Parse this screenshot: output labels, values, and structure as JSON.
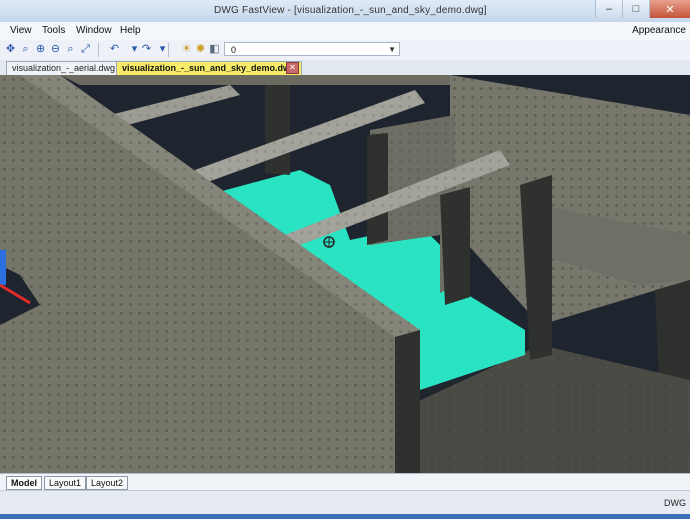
{
  "window": {
    "title": "DWG FastView - [visualization_-_sun_and_sky_demo.dwg]",
    "minimize_glyph": "–",
    "maximize_glyph": "□",
    "close_glyph": "✕"
  },
  "menu": {
    "items": [
      "View",
      "Tools",
      "Window",
      "Help"
    ],
    "right_label": "Appearance"
  },
  "toolbar": {
    "layer_value": "0",
    "icons": [
      "pan-icon",
      "zoom-window-icon",
      "zoom-in-icon",
      "zoom-out-icon",
      "zoom-extents-icon",
      "zoom-all-icon",
      "undo-icon",
      "redo-icon",
      "light-icon",
      "sun-icon",
      "layer-icon"
    ]
  },
  "tabs": {
    "files": [
      {
        "label": "visualization_-_aerial.dwg",
        "active": false
      },
      {
        "label": "visualization_-_sun_and_sky_demo.dwg",
        "active": true
      }
    ]
  },
  "layouts": {
    "tabs": [
      "Model",
      "Layout1",
      "Layout2"
    ]
  },
  "status": {
    "right_text": "DWG"
  },
  "colors": {
    "wall": "#6e6e64",
    "water": "#2ae3c2",
    "background": "#1e252e",
    "active_tab": "#f6ec6a"
  }
}
